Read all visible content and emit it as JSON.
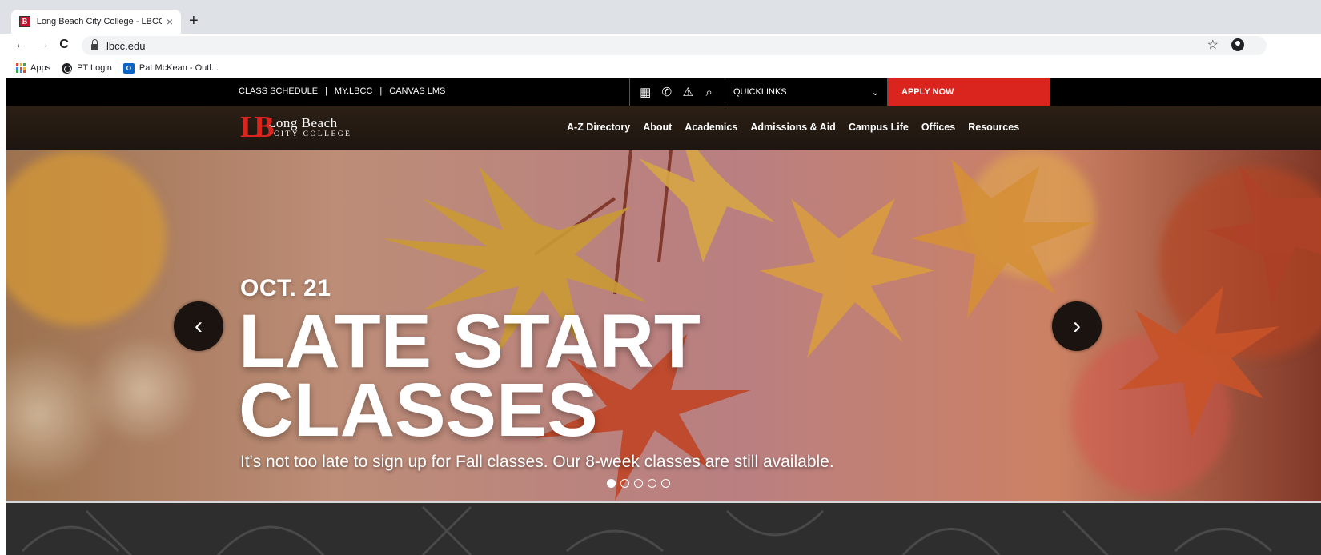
{
  "browser": {
    "tab_title": "Long Beach City College - LBCC",
    "tab_close": "×",
    "new_tab": "+",
    "url": "lbcc.edu",
    "favicon_letter": "B",
    "back": "←",
    "forward": "→",
    "reload": "C",
    "star": "☆",
    "bookmarks": [
      {
        "label": "Apps",
        "icon": "apps-grid-icon"
      },
      {
        "label": "PT Login",
        "icon": "globe-icon"
      },
      {
        "label": "Pat McKean - Outl...",
        "icon": "outlook-icon"
      }
    ]
  },
  "utility": {
    "links": [
      "CLASS SCHEDULE",
      "MY.LBCC",
      "CANVAS LMS"
    ],
    "separator": "|",
    "icons": [
      "calendar-icon",
      "phone-icon",
      "alert-icon",
      "search-icon"
    ],
    "icon_glyphs": [
      "▦",
      "✆",
      "⚠",
      "⌕"
    ],
    "quicklinks": "QUICKLINKS",
    "quicklinks_chevron": "⌄",
    "apply": "APPLY NOW",
    "apply_color": "#d9251d"
  },
  "logo": {
    "mark": "LB",
    "line1": "Long Beach",
    "line2": "CITY COLLEGE"
  },
  "nav": [
    "A-Z Directory",
    "About",
    "Academics",
    "Admissions & Aid",
    "Campus Life",
    "Offices",
    "Resources"
  ],
  "hero": {
    "date": "OCT. 21",
    "title_line1": "LATE START",
    "title_line2": "CLASSES",
    "subtitle": "It's not too late to sign up for Fall classes. Our 8-week classes are still available.",
    "prev": "‹",
    "next": "›",
    "slide_count": 5,
    "active_slide": 1
  }
}
